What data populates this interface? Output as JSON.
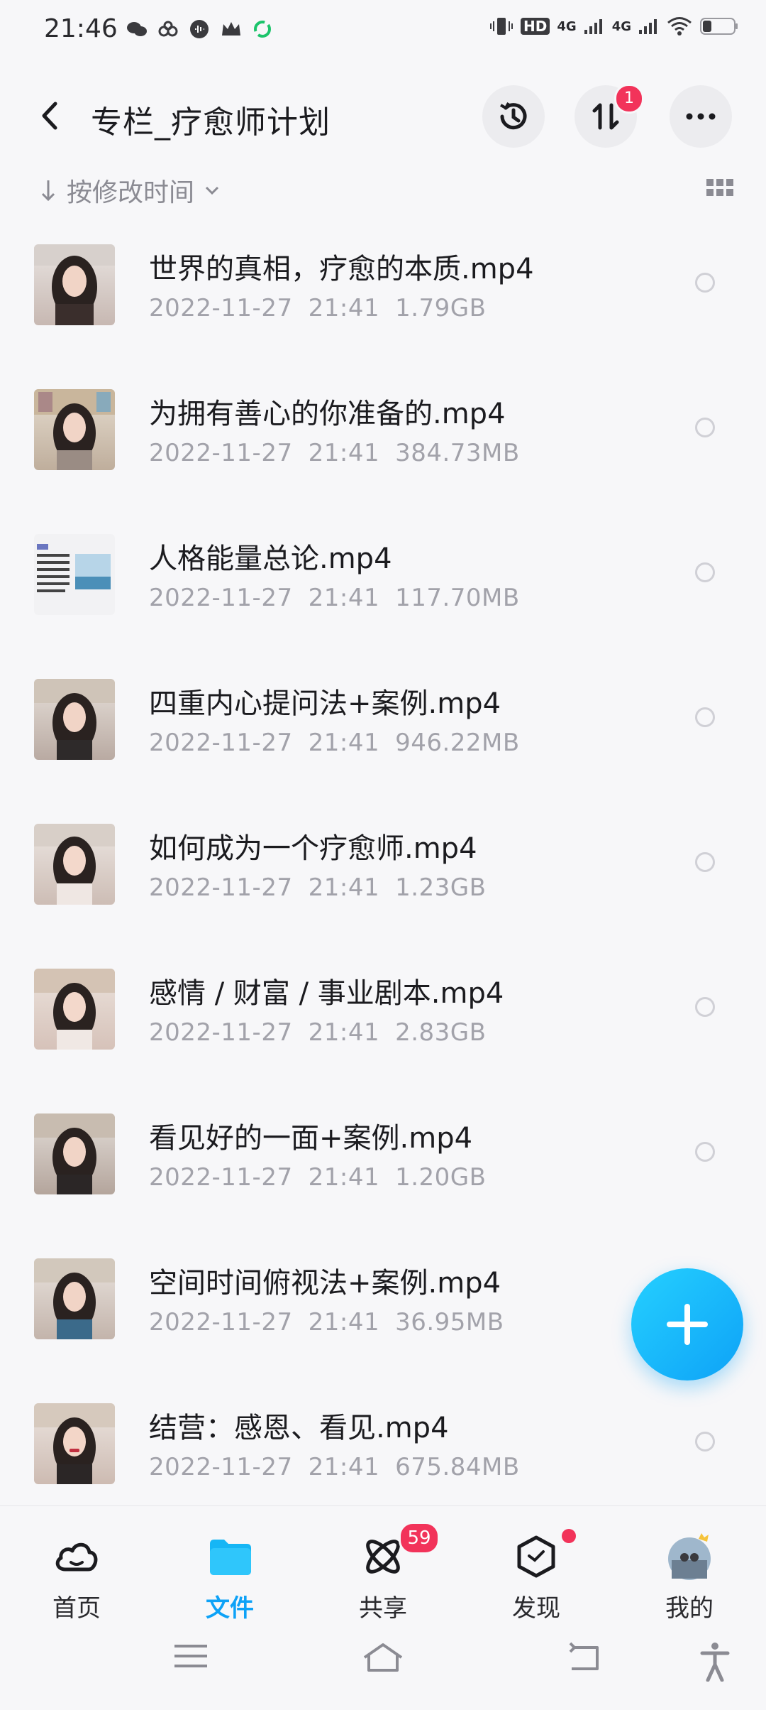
{
  "status": {
    "time": "21:46",
    "hd_label": "HD",
    "net1": "4G",
    "net2": "4G"
  },
  "header": {
    "title": "专栏_疗愈师计划",
    "transfer_badge": "1"
  },
  "sort": {
    "label": "按修改时间"
  },
  "files": [
    {
      "name": "世界的真相，疗愈的本质.mp4",
      "date": "2022-11-27",
      "time": "21:41",
      "size": "1.79GB"
    },
    {
      "name": "为拥有善心的你准备的.mp4",
      "date": "2022-11-27",
      "time": "21:41",
      "size": "384.73MB"
    },
    {
      "name": "人格能量总论.mp4",
      "date": "2022-11-27",
      "time": "21:41",
      "size": "117.70MB"
    },
    {
      "name": "四重内心提问法+案例.mp4",
      "date": "2022-11-27",
      "time": "21:41",
      "size": "946.22MB"
    },
    {
      "name": "如何成为一个疗愈师.mp4",
      "date": "2022-11-27",
      "time": "21:41",
      "size": "1.23GB"
    },
    {
      "name": "感情 / 财富 / 事业剧本.mp4",
      "date": "2022-11-27",
      "time": "21:41",
      "size": "2.83GB"
    },
    {
      "name": "看见好的一面+案例.mp4",
      "date": "2022-11-27",
      "time": "21:41",
      "size": "1.20GB"
    },
    {
      "name": "空间时间俯视法+案例.mp4",
      "date": "2022-11-27",
      "time": "21:41",
      "size": "36.95MB"
    },
    {
      "name": "结营：感恩、看见.mp4",
      "date": "2022-11-27",
      "time": "21:41",
      "size": "675.84MB"
    }
  ],
  "tabs": {
    "home": "首页",
    "files": "文件",
    "share": "共享",
    "discover": "发现",
    "mine": "我的",
    "share_badge": "59"
  },
  "colors": {
    "accent": "#0ea2f7",
    "badge": "#f2335a"
  }
}
